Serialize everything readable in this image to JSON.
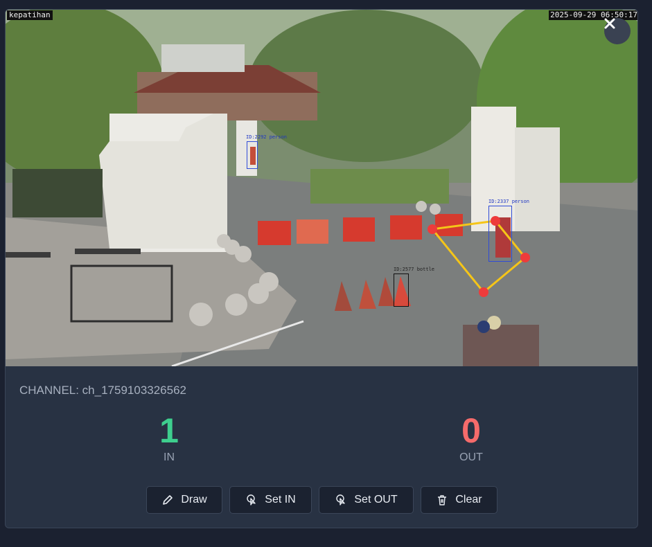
{
  "video": {
    "camera_name": "kepatihan",
    "timestamp": "2025-09-29 06:50:17",
    "detections": [
      {
        "label": "ID:2292 person"
      },
      {
        "label": "ID:2337 person"
      },
      {
        "label": "ID:2577 bottle"
      }
    ],
    "close_icon": "close-icon"
  },
  "channel": {
    "label": "CHANNEL: ch_1759103326562"
  },
  "counters": {
    "in": {
      "value": "1",
      "label": "IN",
      "color": "#3ecf8e"
    },
    "out": {
      "value": "0",
      "label": "OUT",
      "color": "#f56b6b"
    }
  },
  "toolbar": {
    "draw": {
      "label": "Draw",
      "icon": "pencil-icon"
    },
    "set_in": {
      "label": "Set IN",
      "icon": "pointer-click-icon"
    },
    "set_out": {
      "label": "Set OUT",
      "icon": "pointer-click-icon"
    },
    "clear": {
      "label": "Clear",
      "icon": "trash-icon"
    }
  },
  "colors": {
    "polygon_line": "#f5c518",
    "polygon_point": "#ee3b3b"
  }
}
